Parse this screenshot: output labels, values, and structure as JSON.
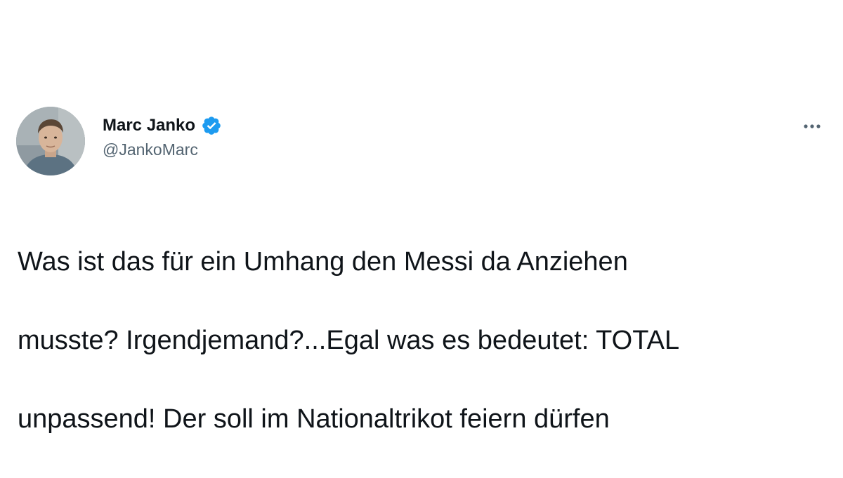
{
  "tweet": {
    "author": {
      "display_name": "Marc Janko",
      "handle": "@JankoMarc",
      "verified": true,
      "avatar_icon": "profile-photo-icon"
    },
    "more_icon": "more-options-icon",
    "text_lines": [
      "Was ist das für ein Umhang den Messi da Anziehen",
      "musste? Irgendjemand?...Egal was es bedeutet: TOTAL",
      "unpassend! Der soll im Nationaltrikot feiern dürfen"
    ]
  },
  "colors": {
    "text_primary": "#0f1419",
    "text_secondary": "#536471",
    "verified_blue": "#1d9bf0",
    "background": "#ffffff"
  }
}
